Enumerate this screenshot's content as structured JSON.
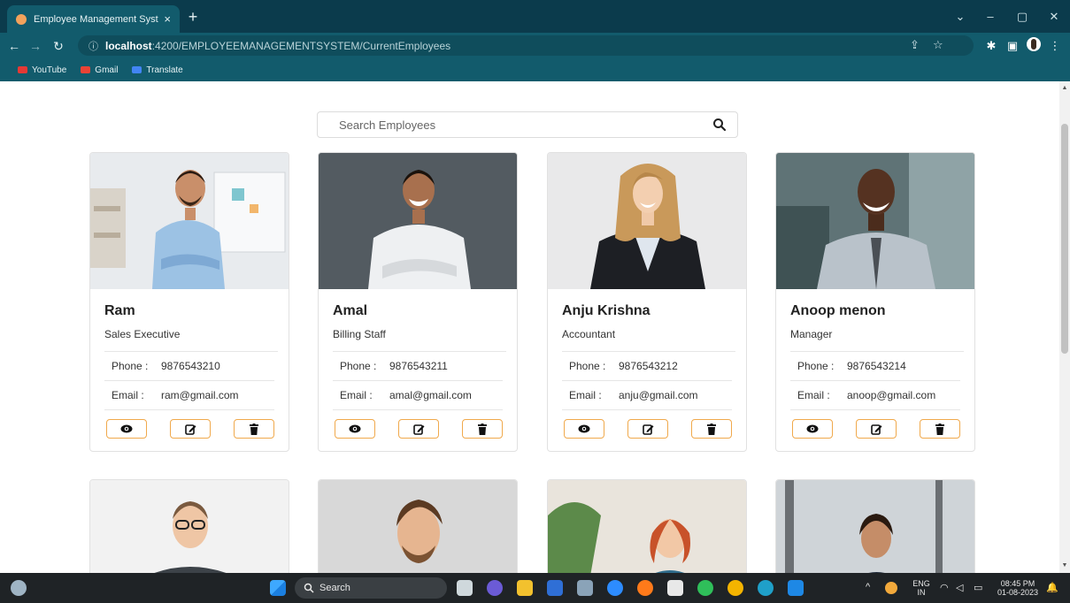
{
  "browser": {
    "tab_title": "Employee Management System",
    "tab_close": "×",
    "new_tab": "+",
    "url_host": "localhost",
    "url_path": ":4200/EMPLOYEEMANAGEMENTSYSTEM/CurrentEmployees",
    "bookmarks": [
      {
        "label": "YouTube",
        "color": "#e53935"
      },
      {
        "label": "Gmail",
        "color": "#ea4335"
      },
      {
        "label": "Translate",
        "color": "#4285f4"
      }
    ]
  },
  "search": {
    "placeholder": "Search Employees"
  },
  "labels": {
    "phone": "Phone :",
    "email": "Email :"
  },
  "employees": [
    {
      "name": "Ram",
      "role": "Sales Executive",
      "phone": "9876543210",
      "email": "ram@gmail.com"
    },
    {
      "name": "Amal",
      "role": "Billing Staff",
      "phone": "9876543211",
      "email": "amal@gmail.com"
    },
    {
      "name": "Anju Krishna",
      "role": "Accountant",
      "phone": "9876543212",
      "email": "anju@gmail.com"
    },
    {
      "name": "Anoop menon",
      "role": "Manager",
      "phone": "9876543214",
      "email": "anoop@gmail.com"
    }
  ],
  "taskbar": {
    "search_label": "Search",
    "lang": "ENG",
    "region": "IN",
    "time": "08:45 PM",
    "date": "01-08-2023"
  },
  "colors": {
    "chrome": "#0b3b4c",
    "toolbar": "#125b6c",
    "button_border": "#f0a94c"
  }
}
